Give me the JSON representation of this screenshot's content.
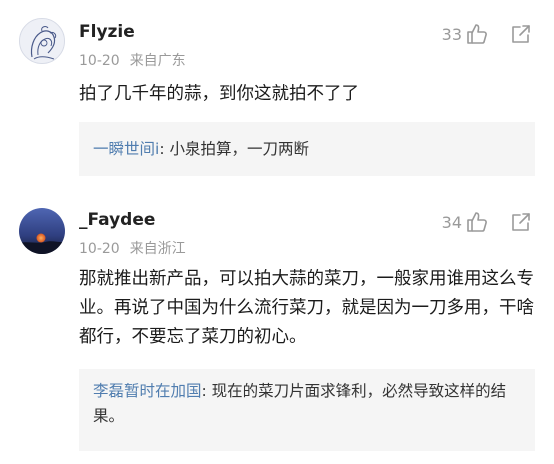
{
  "comments": [
    {
      "username": "Flyzie",
      "date": "10-20",
      "location": "来自广东",
      "likes": "33",
      "text": "拍了几千年的蒜，到你这就拍不了了",
      "reply": {
        "author": "一瞬世间i",
        "text": ": 小泉拍算，一刀两断"
      },
      "icons": [
        "avatar-sketch-icon",
        "thumbs-up-icon",
        "share-icon"
      ]
    },
    {
      "username": "_Faydee",
      "date": "10-20",
      "location": "来自浙江",
      "likes": "34",
      "text": "那就推出新产品，可以拍大蒜的菜刀，一般家用谁用这么专业。再说了中国为什么流行菜刀，就是因为一刀多用，干啥都行，不要忘了菜刀的初心。",
      "reply": {
        "author": "李磊暂时在加国",
        "text": ": 现在的菜刀片面求锋利，必然导致这样的结果。"
      },
      "icons": [
        "avatar-moon-icon",
        "thumbs-up-icon",
        "share-icon"
      ]
    }
  ],
  "colors": {
    "link": "#507daf",
    "meta": "#9a9a9a",
    "reply_bg": "#f5f5f5"
  }
}
